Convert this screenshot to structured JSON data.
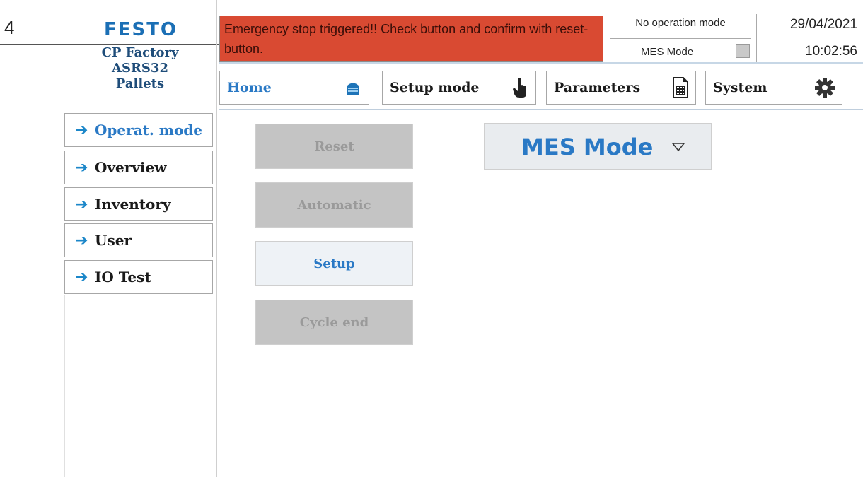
{
  "callout": {
    "number": "4"
  },
  "header": {
    "logo": "FESTO",
    "station": {
      "line1": "CP Factory",
      "line2": "ASRS32",
      "line3": "Pallets"
    }
  },
  "alarm": {
    "message": "Emergency stop triggered!! Check button and confirm with reset-button.",
    "color": "#d94a32"
  },
  "status": {
    "operation_mode": "No operation mode",
    "mes_mode": "MES Mode",
    "date": "29/04/2021",
    "time": "10:02:56"
  },
  "nav": {
    "home": {
      "label": "Home",
      "icon": "home-icon"
    },
    "setup": {
      "label": "Setup mode",
      "icon": "hand-pointer-icon"
    },
    "parameters": {
      "label": "Parameters",
      "icon": "document-table-icon"
    },
    "system": {
      "label": "System",
      "icon": "gear-icon"
    }
  },
  "sidebar": {
    "items": [
      {
        "label": "Operat. mode",
        "active": true
      },
      {
        "label": "Overview"
      },
      {
        "label": "Inventory"
      },
      {
        "label": "User"
      },
      {
        "label": "IO Test"
      }
    ]
  },
  "actions": {
    "reset": {
      "label": "Reset",
      "enabled": false
    },
    "automatic": {
      "label": "Automatic",
      "enabled": false
    },
    "setup": {
      "label": "Setup",
      "enabled": true
    },
    "cycle_end": {
      "label": "Cycle end",
      "enabled": false
    }
  },
  "mode_select": {
    "value": "MES Mode"
  },
  "colors": {
    "accent": "#2a79c5",
    "alarm": "#d94a32",
    "logo": "#1b6fb5"
  }
}
